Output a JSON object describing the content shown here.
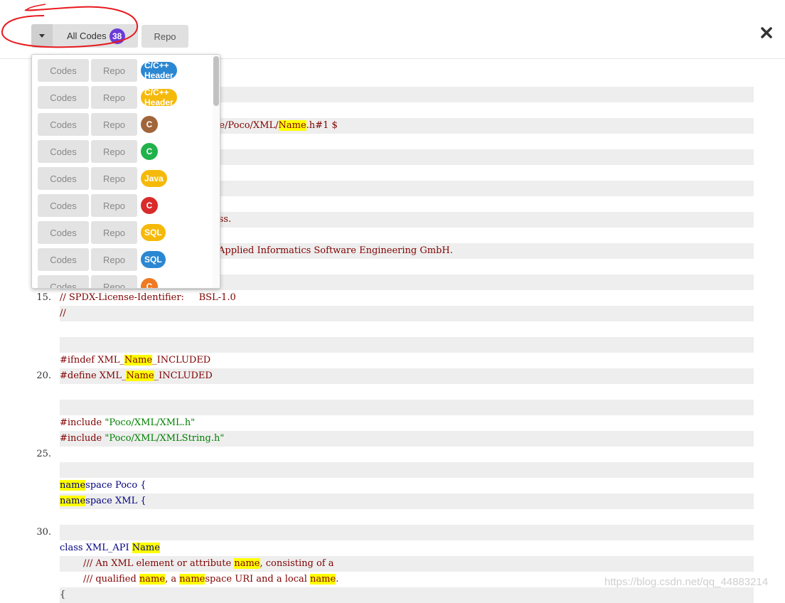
{
  "toolbar": {
    "all_codes_label": "All Codes",
    "all_codes_count": "38",
    "count_color": "#6a3bd8",
    "repo_label": "Repo",
    "close_icon": "close-icon",
    "caret_icon": "caret-down-icon"
  },
  "dropdown": {
    "codes_label": "Codes",
    "repo_label": "Repo",
    "items": [
      {
        "lang": "C/C++ Header",
        "color": "#2b87d1"
      },
      {
        "lang": "C/C++ Header",
        "color": "#f5b90a"
      },
      {
        "lang": "C",
        "color": "#a0653a"
      },
      {
        "lang": "C",
        "color": "#22b24c"
      },
      {
        "lang": "Java",
        "color": "#f5b90a"
      },
      {
        "lang": "C",
        "color": "#d92b2b"
      },
      {
        "lang": "SQL",
        "color": "#f5b90a"
      },
      {
        "lang": "SQL",
        "color": "#2b87d1"
      },
      {
        "lang": "C",
        "color": "#ee7a23"
      }
    ]
  },
  "code": {
    "lines": [
      {
        "num": "",
        "stripe": false,
        "segs": []
      },
      {
        "num": "",
        "stripe": true,
        "segs": []
      },
      {
        "num": "",
        "stripe": false,
        "segs": []
      },
      {
        "num": "",
        "stripe": true,
        "segs": [
          {
            "t": "de/Poco/XML/",
            "c": "cm"
          },
          {
            "t": "Name",
            "c": "cm",
            "hl": true
          },
          {
            "t": ".h#1 $",
            "c": "cm"
          }
        ],
        "offset": 300
      },
      {
        "num": "",
        "stripe": false,
        "segs": []
      },
      {
        "num": "",
        "stripe": true,
        "segs": []
      },
      {
        "num": "",
        "stripe": false,
        "segs": []
      },
      {
        "num": "",
        "stripe": true,
        "segs": []
      },
      {
        "num": "",
        "stripe": false,
        "segs": []
      },
      {
        "num": "",
        "stripe": true,
        "segs": [
          {
            "t": "ass.",
            "c": "cm"
          }
        ],
        "offset": 300
      },
      {
        "num": "",
        "stripe": false,
        "segs": []
      },
      {
        "num": "",
        "stripe": true,
        "segs": [
          {
            "t": "Applied Informatics Software Engineering GmbH.",
            "c": "cm"
          }
        ],
        "offset": 307
      },
      {
        "num": "",
        "stripe": false,
        "segs": []
      },
      {
        "num": "",
        "stripe": true,
        "segs": []
      },
      {
        "num": "15.",
        "stripe": false,
        "segs": [
          {
            "t": "// SPDX-License-Identifier:     BSL-1.0",
            "c": "cm"
          }
        ]
      },
      {
        "num": "",
        "stripe": true,
        "segs": [
          {
            "t": "//",
            "c": "cm"
          }
        ]
      },
      {
        "num": "",
        "stripe": false,
        "segs": []
      },
      {
        "num": "",
        "stripe": true,
        "segs": []
      },
      {
        "num": "",
        "stripe": false,
        "segs": [
          {
            "t": "#ifndef XML_",
            "c": "pp"
          },
          {
            "t": "Name",
            "c": "pp",
            "hl": true
          },
          {
            "t": "_INCLUDED",
            "c": "pp"
          }
        ]
      },
      {
        "num": "20.",
        "stripe": true,
        "segs": [
          {
            "t": "#define XML_",
            "c": "pp"
          },
          {
            "t": "Name",
            "c": "pp",
            "hl": true
          },
          {
            "t": "_INCLUDED",
            "c": "pp"
          }
        ]
      },
      {
        "num": "",
        "stripe": false,
        "segs": []
      },
      {
        "num": "",
        "stripe": true,
        "segs": []
      },
      {
        "num": "",
        "stripe": false,
        "segs": [
          {
            "t": "#include ",
            "c": "pp"
          },
          {
            "t": "\"Poco/XML/XML.h\"",
            "c": "str"
          }
        ]
      },
      {
        "num": "",
        "stripe": true,
        "segs": [
          {
            "t": "#include ",
            "c": "pp"
          },
          {
            "t": "\"Poco/XML/XMLString.h\"",
            "c": "str"
          }
        ]
      },
      {
        "num": "25.",
        "stripe": false,
        "segs": []
      },
      {
        "num": "",
        "stripe": true,
        "segs": []
      },
      {
        "num": "",
        "stripe": false,
        "segs": [
          {
            "t": "name",
            "c": "kw",
            "hl": true
          },
          {
            "t": "space Poco {",
            "c": "kw"
          }
        ]
      },
      {
        "num": "",
        "stripe": true,
        "segs": [
          {
            "t": "name",
            "c": "kw",
            "hl": true
          },
          {
            "t": "space XML {",
            "c": "kw"
          }
        ]
      },
      {
        "num": "",
        "stripe": false,
        "segs": []
      },
      {
        "num": "30.",
        "stripe": true,
        "segs": []
      },
      {
        "num": "",
        "stripe": false,
        "segs": [
          {
            "t": "class XML_API ",
            "c": "kw"
          },
          {
            "t": "Name",
            "c": "kw",
            "hl": true
          }
        ]
      },
      {
        "num": "",
        "stripe": true,
        "segs": [
          {
            "t": "        /// An XML element or attribute ",
            "c": "cm"
          },
          {
            "t": "name",
            "c": "cm",
            "hl": true
          },
          {
            "t": ", consisting of a",
            "c": "cm"
          }
        ]
      },
      {
        "num": "",
        "stripe": false,
        "segs": [
          {
            "t": "        /// qualified ",
            "c": "cm"
          },
          {
            "t": "name",
            "c": "cm",
            "hl": true
          },
          {
            "t": ", a ",
            "c": "cm"
          },
          {
            "t": "name",
            "c": "cm",
            "hl": true
          },
          {
            "t": "space URI and a local ",
            "c": "cm"
          },
          {
            "t": "name",
            "c": "cm",
            "hl": true
          },
          {
            "t": ".",
            "c": "cm"
          }
        ]
      },
      {
        "num": "",
        "stripe": true,
        "segs": [
          {
            "t": "{",
            "c": "plain"
          }
        ]
      }
    ]
  },
  "watermark": "https://blog.csdn.net/qq_44883214"
}
